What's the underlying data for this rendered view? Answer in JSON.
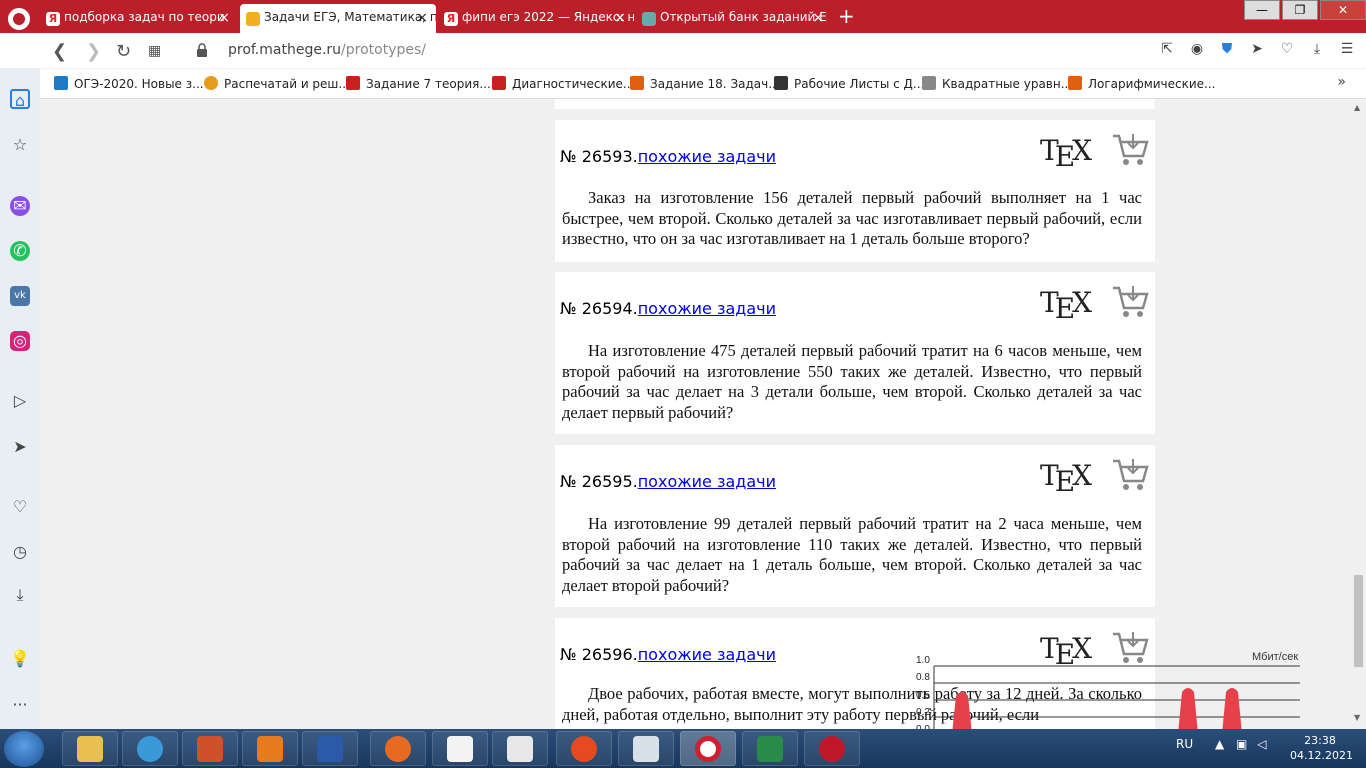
{
  "tabs": [
    {
      "title": "подборка задач по теори",
      "icon_color": "#ee2222",
      "icon_text": "Я",
      "active": false
    },
    {
      "title": "Задачи ЕГЭ, Математика, п",
      "icon_color": "#2c5aa0",
      "icon_text": "",
      "active": true
    },
    {
      "title": "фипи егэ 2022 — Яндекс: н",
      "icon_color": "#ee2222",
      "icon_text": "Я",
      "active": false
    },
    {
      "title": "Открытый банк заданий Е",
      "icon_color": "#3a7a5a",
      "icon_text": "",
      "active": false
    }
  ],
  "url": {
    "host": "prof.mathege.ru",
    "path": "/prototypes/"
  },
  "bookmarks": [
    {
      "label": "ОГЭ-2020. Новые з...",
      "color": "#1f7ac4"
    },
    {
      "label": "Распечатай и реш...",
      "color": "#e89a1a"
    },
    {
      "label": "Задание 7 теория...",
      "color": "#c82020"
    },
    {
      "label": "Диагностические...",
      "color": "#c82020"
    },
    {
      "label": "Задание 18. Задач...",
      "color": "#e06010"
    },
    {
      "label": "Рабочие Листы с Д...",
      "color": "#333333"
    },
    {
      "label": "Квадратные уравн...",
      "color": "#555555"
    },
    {
      "label": "Логарифмические...",
      "color": "#e06010"
    }
  ],
  "problems": [
    {
      "number": "№ 26593.",
      "link": "похожие задачи",
      "text": "Заказ на изготовление 156 деталей первый рабочий выполняет на 1 час быстрее, чем второй. Сколько деталей за час изготавливает первый рабочий, если известно, что он за час изготавливает на 1 деталь больше второго?"
    },
    {
      "number": "№ 26594.",
      "link": "похожие задачи",
      "text": "На изготовление 475 деталей первый рабочий тратит на 6 часов меньше, чем второй рабочий на изготовление 550 таких же деталей. Известно, что первый рабочий за час делает на 3 детали больше, чем второй. Сколько деталей за час делает первый рабочий?"
    },
    {
      "number": "№ 26595.",
      "link": "похожие задачи",
      "text": "На изготовление 99 деталей первый рабочий тратит на 2 часа меньше, чем второй рабочий на изготовление 110 таких же деталей. Известно, что первый рабочий за час делает на 1 деталь больше, чем второй. Сколько деталей за час делает второй рабочий?"
    },
    {
      "number": "№ 26596.",
      "link": "похожие задачи",
      "text": "Двое рабочих, работая вместе, могут выполнить работу за 12 дней. За сколько дней, работая отдельно, выполнит эту работу первый рабочий, если"
    }
  ],
  "tex_label_t": "T",
  "tex_label_e": "E",
  "tex_label_x": "X",
  "netgraph": {
    "unit": "Мбит/сек",
    "ticks": [
      "1.0",
      "0.8",
      "0.5",
      "0.2",
      "0.0"
    ]
  },
  "tray": {
    "lang": "RU",
    "time": "23:38",
    "date": "04.12.2021"
  }
}
